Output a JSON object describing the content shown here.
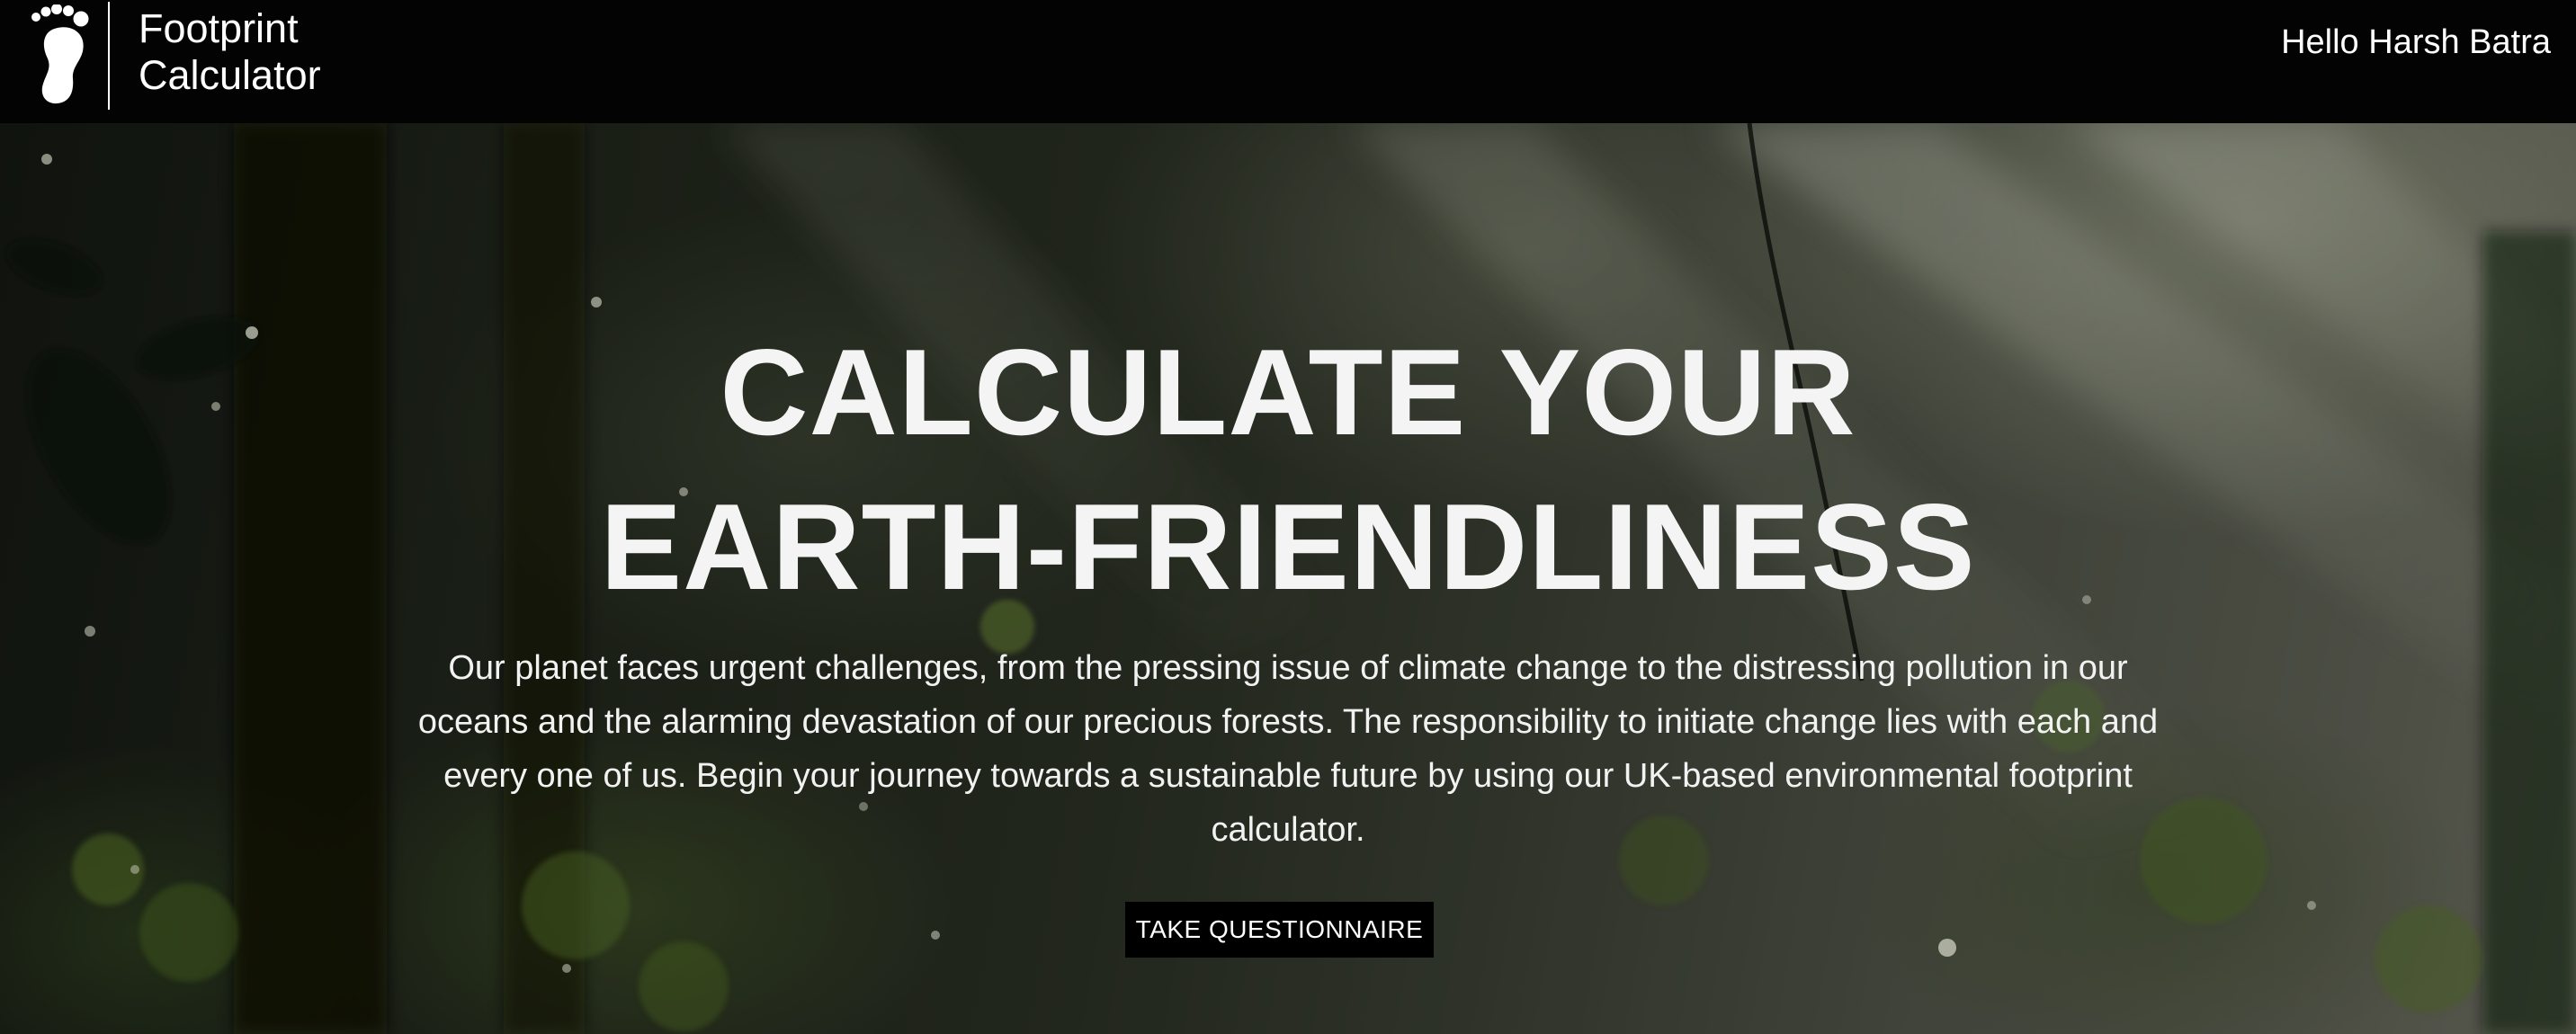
{
  "navbar": {
    "brand_line1": "Footprint",
    "brand_line2": "Calculator",
    "logo_icon": "footprint-icon",
    "greeting": "Hello Harsh Batra"
  },
  "hero": {
    "title_line1": "CALCULATE YOUR",
    "title_line2": "EARTH-FRIENDLINESS",
    "description": "Our planet faces urgent challenges, from the pressing issue of climate change to the distressing pollution in our oceans and the alarming devastation of our precious forests. The responsibility to initiate change lies with each and every one of us. Begin your journey towards a sustainable future by using our UK-based environmental footprint calculator.",
    "cta_label": "TAKE QUESTIONNAIRE",
    "background": "forest-photo"
  },
  "colors": {
    "navbar_bg": "#030303",
    "text_primary": "#ffffff",
    "button_bg": "#000000"
  }
}
